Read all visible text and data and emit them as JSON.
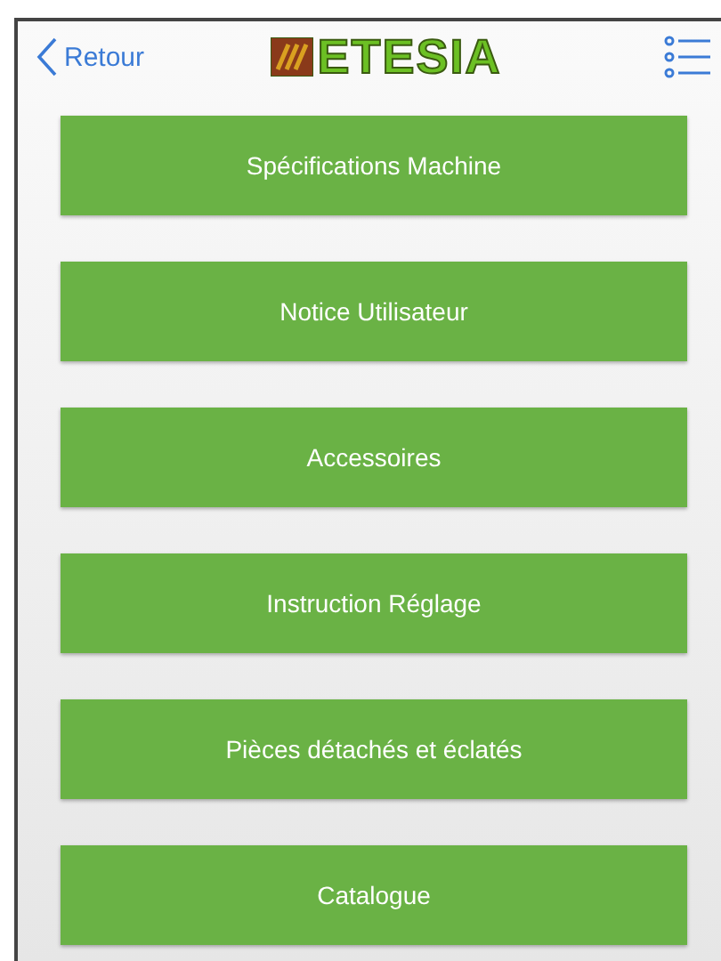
{
  "nav": {
    "back": "Retour",
    "logo": "ETESIA"
  },
  "buttons": [
    "Spécifications Machine",
    "Notice Utilisateur",
    "Accessoires",
    "Instruction Réglage",
    "Pièces détachés et éclatés",
    "Catalogue"
  ]
}
